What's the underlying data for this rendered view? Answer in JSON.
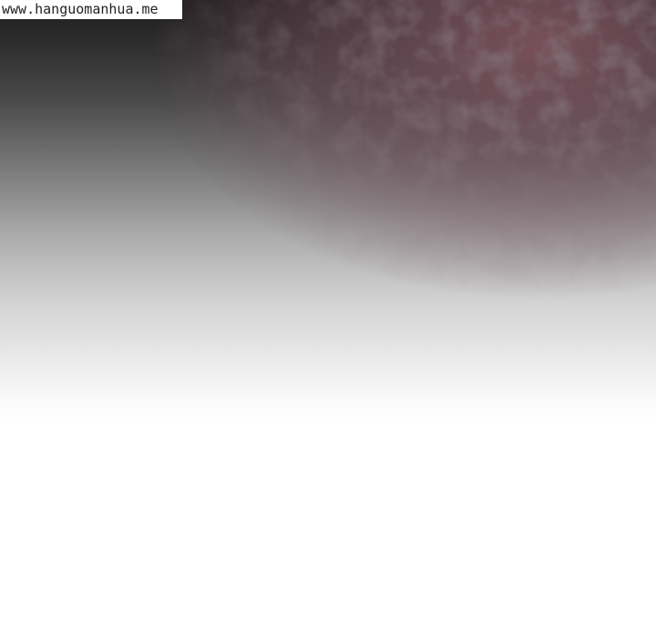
{
  "watermark": {
    "text": "www.hanguomanhua.me"
  },
  "colors": {
    "background": "#ffffff",
    "dark_top": "#1e1e1e",
    "texture_tint": "#7a4a56",
    "watermark_bg": "#ffffff",
    "watermark_text": "#222222"
  }
}
